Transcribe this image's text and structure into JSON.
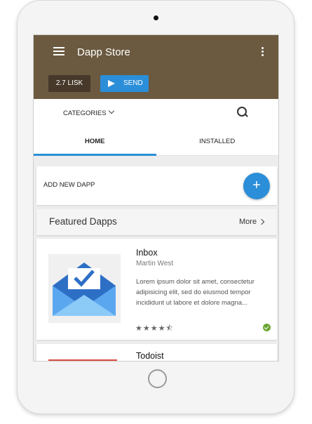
{
  "appbar": {
    "title": "Dapp Store",
    "balance": "2.7 LISK",
    "send_label": "SEND",
    "color": "#6b5a40"
  },
  "toolbar": {
    "categories_label": "CATEGORIES"
  },
  "tabs": [
    {
      "label": "HOME",
      "active": true
    },
    {
      "label": "INSTALLED",
      "active": false
    }
  ],
  "add_card": {
    "label": "ADD NEW DAPP",
    "fab_symbol": "+"
  },
  "featured": {
    "title": "Featured Dapps",
    "more_label": "More"
  },
  "apps": [
    {
      "name": "Inbox",
      "author": "Martin West",
      "description": "Lorem ipsum dolor sit amet, consectetur adipisicing elit, sed do eiusmod tempor incididunt ut labore et dolore magna...",
      "rating": 4.5,
      "stars_text": "★★★★⯪",
      "installed": true,
      "icon": "inbox-envelope-icon"
    },
    {
      "name": "Todoist",
      "icon": "todoist-icon"
    }
  ],
  "colors": {
    "accent": "#2b8ed8",
    "installed_check": "#6aa631"
  }
}
